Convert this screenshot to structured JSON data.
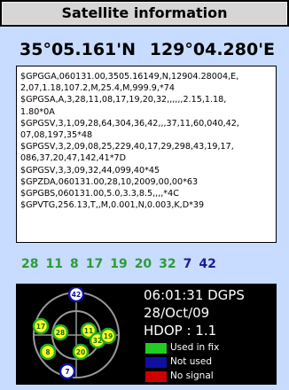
{
  "title": "Satellite information",
  "position": {
    "latitude": "35°05.161'N",
    "longitude": "129°04.280'E"
  },
  "nmea_lines": [
    "$GPGGA,060131.00,3505.16149,N,12904.28004,E,",
    "2,07,1.18,107.2,M,25.4,M,999.9,*74",
    "$GPGSA,A,3,28,11,08,17,19,20,32,,,,,,2.15,1.18,",
    "1.80*0A",
    "$GPGSV,3,1,09,28,64,304,36,42,,,37,11,60,040,42,",
    "07,08,197,35*48",
    "$GPGSV,3,2,09,08,25,229,40,17,29,298,43,19,17,",
    "086,37,20,47,142,41*7D",
    "$GPGSV,3,3,09,32,44,099,40*45",
    "$GPZDA,060131.00,28,10,2009,00,00*63",
    "$GPGBS,060131.00,5.0,3.3,8.5,,,,*4C",
    "$GPVTG,256.13,T,,M,0.001,N,0.003,K,D*39"
  ],
  "satellite_ids": [
    {
      "id": "28",
      "color": "#2f9a3a"
    },
    {
      "id": "11",
      "color": "#2f9a3a"
    },
    {
      "id": "8",
      "color": "#2f9a3a"
    },
    {
      "id": "17",
      "color": "#2f9a3a"
    },
    {
      "id": "19",
      "color": "#2f9a3a"
    },
    {
      "id": "20",
      "color": "#2f9a3a"
    },
    {
      "id": "32",
      "color": "#2f9a3a"
    },
    {
      "id": "7",
      "color": "#1a1aa0"
    },
    {
      "id": "42",
      "color": "#1a1aa0"
    }
  ],
  "status": {
    "time_fix": "06:01:31 DGPS",
    "date": "28/Oct/09",
    "hdop": "HDOP : 1.1"
  },
  "legend": [
    {
      "label": "Used in fix",
      "color": "#22cc22"
    },
    {
      "label": "Not used",
      "color": "#1010a0"
    },
    {
      "label": "No signal",
      "color": "#cc0000"
    }
  ],
  "skyplot": {
    "satellites": [
      {
        "id": "42",
        "state": "not-used"
      },
      {
        "id": "17",
        "state": "used"
      },
      {
        "id": "28",
        "state": "used"
      },
      {
        "id": "11",
        "state": "used"
      },
      {
        "id": "32",
        "state": "used"
      },
      {
        "id": "19",
        "state": "used"
      },
      {
        "id": "8",
        "state": "used"
      },
      {
        "id": "20",
        "state": "used"
      },
      {
        "id": "7",
        "state": "not-used"
      }
    ]
  }
}
